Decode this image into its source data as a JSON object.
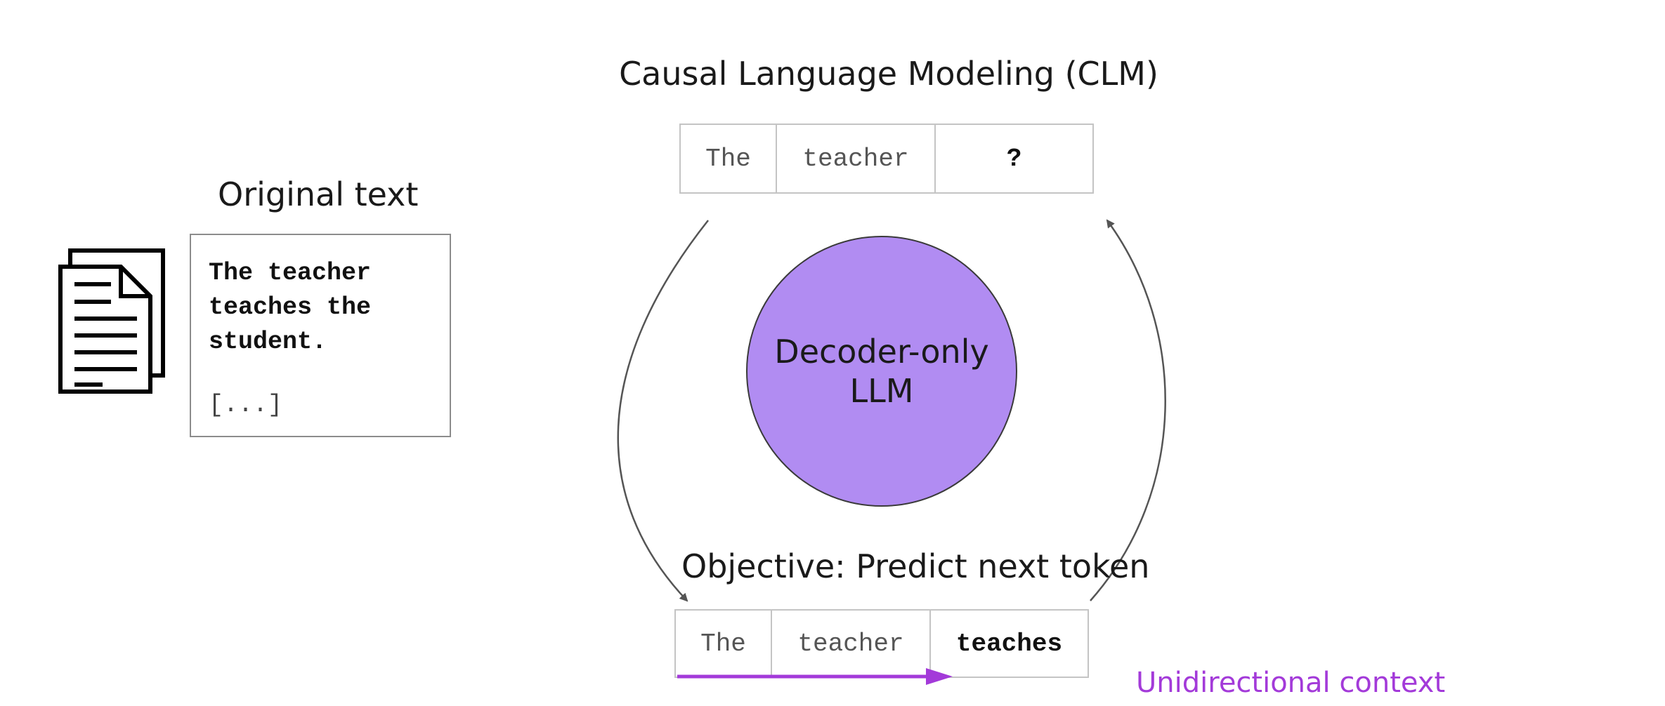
{
  "title": "Causal Language Modeling (CLM)",
  "original_text": {
    "heading": "Original text",
    "body": "The teacher\nteaches the\nstudent.",
    "ellipsis": "[...]",
    "icon": "document-icon"
  },
  "top_tokens": [
    "The",
    "teacher",
    "?"
  ],
  "model": {
    "line1": "Decoder-only",
    "line2": "LLM",
    "fill_color": "#b18cf2"
  },
  "objective": "Objective: Predict next token",
  "bottom_tokens": [
    "The",
    "teacher",
    "teaches"
  ],
  "context_label": "Unidirectional context",
  "accent_color": "#a33ad9"
}
